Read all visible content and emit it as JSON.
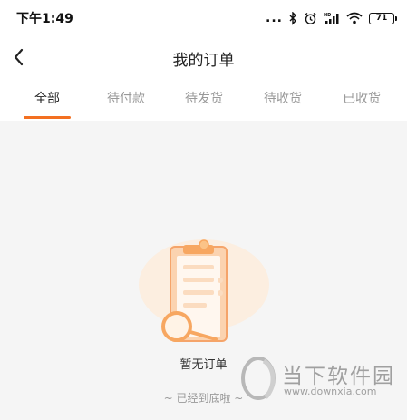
{
  "status_bar": {
    "time": "下午1:49",
    "dots": "...",
    "battery": "71"
  },
  "header": {
    "back_icon": "chevron-left-icon",
    "title": "我的订单"
  },
  "tabs": [
    {
      "label": "全部",
      "active": true
    },
    {
      "label": "待付款",
      "active": false
    },
    {
      "label": "待发货",
      "active": false
    },
    {
      "label": "待收货",
      "active": false
    },
    {
      "label": "已收货",
      "active": false
    }
  ],
  "empty_state": {
    "illustration": "clipboard-magnifier-icon",
    "message": "暂无订单",
    "end_of_list": "~ 已经到底啦 ~"
  },
  "watermark": {
    "name": "当下软件园",
    "url": "www.downxia.com"
  },
  "colors": {
    "accent": "#f37021",
    "background": "#f5f5f5",
    "illustration_light": "#fdebd8"
  }
}
